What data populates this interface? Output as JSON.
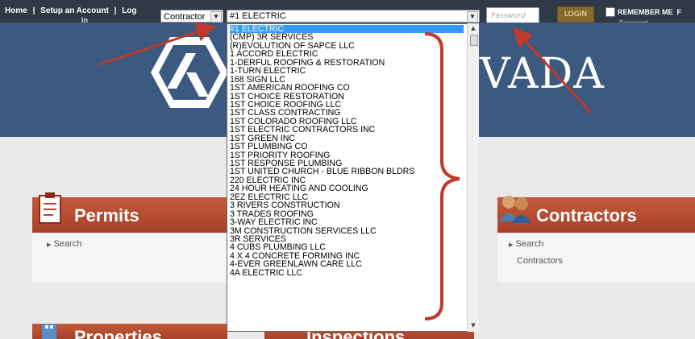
{
  "topnav": {
    "home": "Home",
    "setup": "Setup an Account",
    "login": "Log",
    "login_wrap": "In",
    "separator": "|"
  },
  "type_select": {
    "value": "Contractor",
    "arrow": "▼"
  },
  "name_select": {
    "value": "#1 ELECTRIC",
    "arrow": "▼"
  },
  "password": {
    "placeholder": "Password"
  },
  "login_button": "LOGIN",
  "remember_me": "REMEMBER ME",
  "right_cut": "F",
  "forgot": "Password",
  "logo": {
    "text": "VADA"
  },
  "sections": {
    "permits": {
      "title": "Permits",
      "links": [
        "Search"
      ]
    },
    "contractors": {
      "title": "Contractors",
      "links": [
        "Search",
        "Contractors"
      ]
    },
    "properties": {
      "title": "Properties"
    },
    "inspections": {
      "title": "Inspections"
    }
  },
  "listbox_items": [
    "#1 ELECTRIC",
    "(CMP) 3R SERVICES",
    "(R)EVOLUTION OF SAPCE LLC",
    "1 ACCORD ELECTRIC",
    "1-DERFUL ROOFING & RESTORATION",
    "1-TURN ELECTRIC",
    "168 SIGN LLC",
    "1ST AMERICAN ROOFING CO",
    "1ST CHOICE RESTORATION",
    "1ST CHOICE ROOFING LLC",
    "1ST CLASS CONTRACTING",
    "1ST COLORADO ROOFING LLC",
    "1ST ELECTRIC CONTRACTORS INC",
    "1ST GREEN INC",
    "1ST PLUMBING CO",
    "1ST PRIORITY ROOFING",
    "1ST RESPONSE PLUMBING",
    "1ST UNITED CHURCH - BLUE RIBBON BLDRS",
    "220 ELECTRIC INC",
    "24 HOUR HEATING AND COOLING",
    "2EZ ELECTRIC LLC",
    "3 RIVERS CONSTRUCTION",
    "3 TRADES ROOFING",
    "3-WAY ELECTRIC INC",
    "3M CONSTRUCTION SERVICES LLC",
    "3R SERVICES",
    "4 CUBS PLUMBING LLC",
    "4 X 4 CONCRETE FORMING INC",
    "4-EVER GREENLAWN CARE LLC",
    "4A ELECTRIC LLC"
  ],
  "colors": {
    "topbar": "#2f3a46",
    "header": "#3c5a80",
    "section": "#b04a2f",
    "selection": "#3399ff",
    "annotation": "#c0392b"
  }
}
